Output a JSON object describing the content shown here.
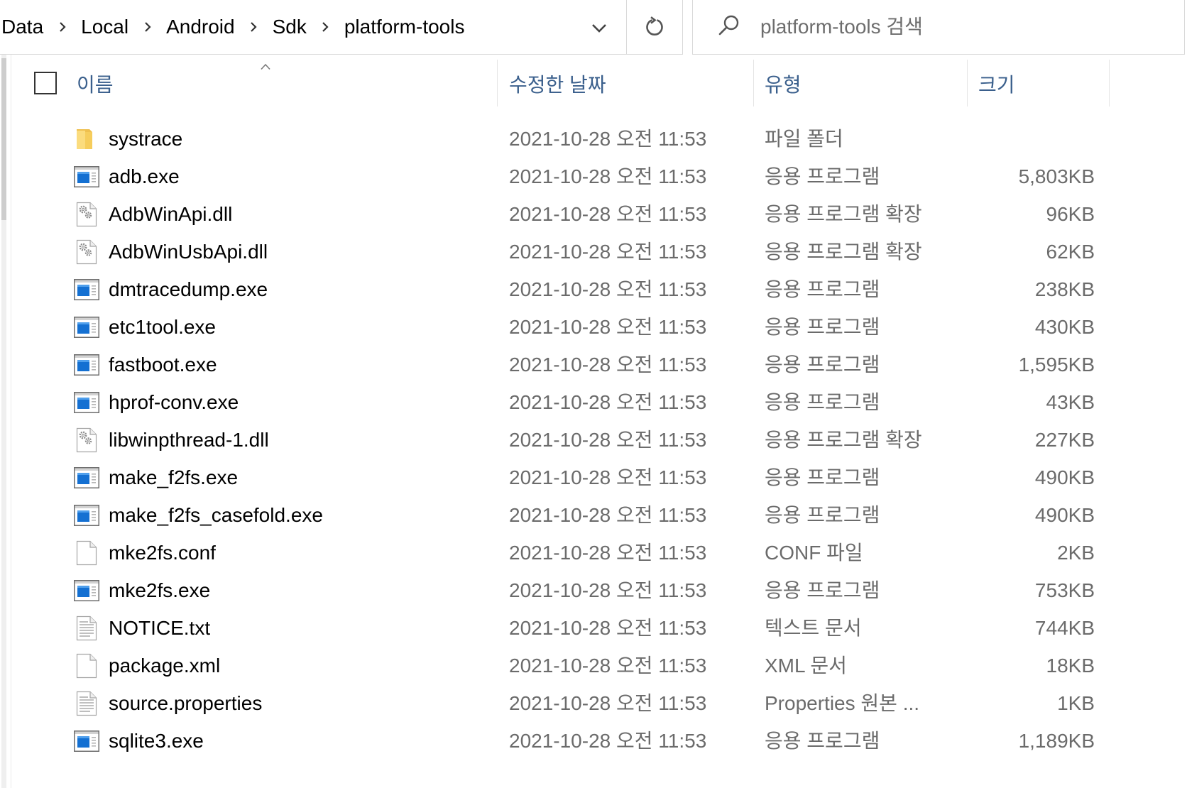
{
  "address_bar": {
    "breadcrumb": [
      "Data",
      "Local",
      "Android",
      "Sdk",
      "platform-tools"
    ]
  },
  "search": {
    "placeholder": "platform-tools 검색"
  },
  "columns": {
    "name": "이름",
    "modified": "수정한 날짜",
    "type": "유형",
    "size": "크기"
  },
  "files": [
    {
      "icon": "folder-icon",
      "name": "systrace",
      "modified": "2021-10-28 오전 11:53",
      "type": "파일 폴더",
      "size": ""
    },
    {
      "icon": "exe-icon",
      "name": "adb.exe",
      "modified": "2021-10-28 오전 11:53",
      "type": "응용 프로그램",
      "size": "5,803KB"
    },
    {
      "icon": "dll-icon",
      "name": "AdbWinApi.dll",
      "modified": "2021-10-28 오전 11:53",
      "type": "응용 프로그램 확장",
      "size": "96KB"
    },
    {
      "icon": "dll-icon",
      "name": "AdbWinUsbApi.dll",
      "modified": "2021-10-28 오전 11:53",
      "type": "응용 프로그램 확장",
      "size": "62KB"
    },
    {
      "icon": "exe-icon",
      "name": "dmtracedump.exe",
      "modified": "2021-10-28 오전 11:53",
      "type": "응용 프로그램",
      "size": "238KB"
    },
    {
      "icon": "exe-icon",
      "name": "etc1tool.exe",
      "modified": "2021-10-28 오전 11:53",
      "type": "응용 프로그램",
      "size": "430KB"
    },
    {
      "icon": "exe-icon",
      "name": "fastboot.exe",
      "modified": "2021-10-28 오전 11:53",
      "type": "응용 프로그램",
      "size": "1,595KB"
    },
    {
      "icon": "exe-icon",
      "name": "hprof-conv.exe",
      "modified": "2021-10-28 오전 11:53",
      "type": "응용 프로그램",
      "size": "43KB"
    },
    {
      "icon": "dll-icon",
      "name": "libwinpthread-1.dll",
      "modified": "2021-10-28 오전 11:53",
      "type": "응용 프로그램 확장",
      "size": "227KB"
    },
    {
      "icon": "exe-icon",
      "name": "make_f2fs.exe",
      "modified": "2021-10-28 오전 11:53",
      "type": "응용 프로그램",
      "size": "490KB"
    },
    {
      "icon": "exe-icon",
      "name": "make_f2fs_casefold.exe",
      "modified": "2021-10-28 오전 11:53",
      "type": "응용 프로그램",
      "size": "490KB"
    },
    {
      "icon": "file-icon",
      "name": "mke2fs.conf",
      "modified": "2021-10-28 오전 11:53",
      "type": "CONF 파일",
      "size": "2KB"
    },
    {
      "icon": "exe-icon",
      "name": "mke2fs.exe",
      "modified": "2021-10-28 오전 11:53",
      "type": "응용 프로그램",
      "size": "753KB"
    },
    {
      "icon": "text-file-icon",
      "name": "NOTICE.txt",
      "modified": "2021-10-28 오전 11:53",
      "type": "텍스트 문서",
      "size": "744KB"
    },
    {
      "icon": "file-icon",
      "name": "package.xml",
      "modified": "2021-10-28 오전 11:53",
      "type": "XML 문서",
      "size": "18KB"
    },
    {
      "icon": "text-file-icon",
      "name": "source.properties",
      "modified": "2021-10-28 오전 11:53",
      "type": "Properties 원본 ...",
      "size": "1KB"
    },
    {
      "icon": "exe-icon",
      "name": "sqlite3.exe",
      "modified": "2021-10-28 오전 11:53",
      "type": "응용 프로그램",
      "size": "1,189KB"
    }
  ]
}
